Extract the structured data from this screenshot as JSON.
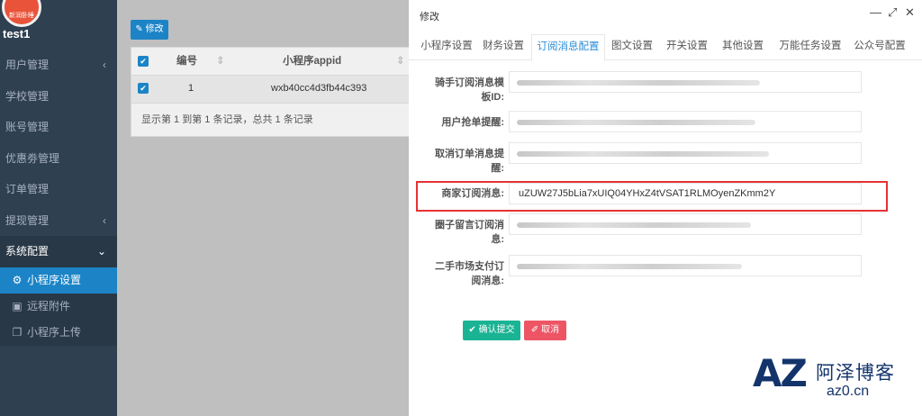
{
  "sidebar": {
    "logo_text": "新润卧睡",
    "username": "test1",
    "items": [
      {
        "label": "用户管理",
        "chevron": "‹"
      },
      {
        "label": "学校管理",
        "chevron": ""
      },
      {
        "label": "账号管理",
        "chevron": ""
      },
      {
        "label": "优惠劵管理",
        "chevron": ""
      },
      {
        "label": "订单管理",
        "chevron": ""
      },
      {
        "label": "提现管理",
        "chevron": "‹"
      },
      {
        "label": "系统配置",
        "chevron": "⌄"
      }
    ],
    "sub_items": [
      {
        "label": "小程序设置",
        "icon": "gear-icon"
      },
      {
        "label": "远程附件",
        "icon": "image-icon"
      },
      {
        "label": "小程序上传",
        "icon": "copy-icon"
      }
    ]
  },
  "main": {
    "edit_button": "✎ 修改",
    "table": {
      "headers": [
        "编号",
        "小程序appid"
      ],
      "rows": [
        {
          "id": "1",
          "appid": "wxb40cc4d3fb44c393"
        }
      ],
      "footer": "显示第 1 到第 1 条记录，总共 1 条记录"
    }
  },
  "modal": {
    "title": "修改",
    "controls": {
      "minimize": "—",
      "restore": "⤢",
      "close": "✕"
    },
    "tabs": [
      "小程序设置",
      "财务设置",
      "订阅消息配置",
      "图文设置",
      "开关设置",
      "其他设置",
      "万能任务设置",
      "公众号配置"
    ],
    "active_tab": "订阅消息配置",
    "fields": [
      {
        "label_lines": [
          "骑手订阅消息模",
          "板ID:"
        ],
        "value": ""
      },
      {
        "label_lines": [
          "用户抢单提醒:"
        ],
        "value": ""
      },
      {
        "label_lines": [
          "取消订单消息提",
          "醒:"
        ],
        "value": ""
      },
      {
        "label_lines": [
          "商家订阅消息:"
        ],
        "value": "uZUW27J5bLia7xUIQ04YHxZ4tVSAT1RLMOyenZKmm2Y"
      },
      {
        "label_lines": [
          "圈子留言订阅消",
          "息:"
        ],
        "value": ""
      },
      {
        "label_lines": [
          "二手市场支付订",
          "阅消息:"
        ],
        "value": ""
      }
    ],
    "submit_label": "✔ 确认提交",
    "cancel_label": "✐ 取消"
  },
  "watermark": {
    "logo": "AZ",
    "site_name": "阿泽博客",
    "url": "az0.cn"
  },
  "colors": {
    "sidebar_bg": "#2f4050",
    "primary": "#1c84c6",
    "success": "#1ab394",
    "danger": "#ed5565",
    "highlight_border": "#e53333"
  }
}
